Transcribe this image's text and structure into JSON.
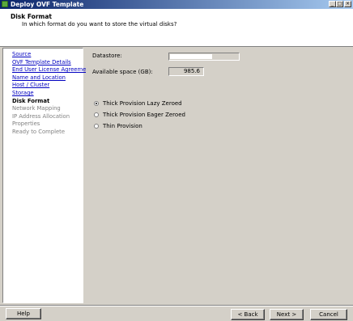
{
  "window": {
    "title": "Deploy OVF Template",
    "minimize_glyph": "_",
    "maximize_glyph": "□",
    "close_glyph": "×"
  },
  "header": {
    "title": "Disk Format",
    "subtitle": "In which format do you want to store the virtual disks?"
  },
  "sidebar": {
    "steps": [
      {
        "label": "Source",
        "state": "done"
      },
      {
        "label": "OVF Template Details",
        "state": "done"
      },
      {
        "label": "End User License Agreement",
        "state": "done"
      },
      {
        "label": "Name and Location",
        "state": "done"
      },
      {
        "label": "Host / Cluster",
        "state": "done"
      },
      {
        "label": "Storage",
        "state": "done"
      },
      {
        "label": "Disk Format",
        "state": "current"
      },
      {
        "label": "Network Mapping",
        "state": "pending"
      },
      {
        "label": "IP Address Allocation",
        "state": "pending"
      },
      {
        "label": "Properties",
        "state": "pending"
      },
      {
        "label": "Ready to Complete",
        "state": "pending"
      }
    ]
  },
  "form": {
    "datastore_label": "Datastore:",
    "datastore_value": "",
    "space_label": "Available space (GB):",
    "space_value": "985.6",
    "options": [
      {
        "label": "Thick Provision Lazy Zeroed",
        "selected": true
      },
      {
        "label": "Thick Provision Eager Zeroed",
        "selected": false
      },
      {
        "label": "Thin Provision",
        "selected": false
      }
    ]
  },
  "buttons": {
    "help": "Help",
    "back": "< Back",
    "next": "Next >",
    "cancel": "Cancel"
  },
  "colors": {
    "link": "#0000c0",
    "titlebar_start": "#0a246a",
    "titlebar_end": "#a6caf0",
    "dialog_bg": "#d4d0c8"
  }
}
